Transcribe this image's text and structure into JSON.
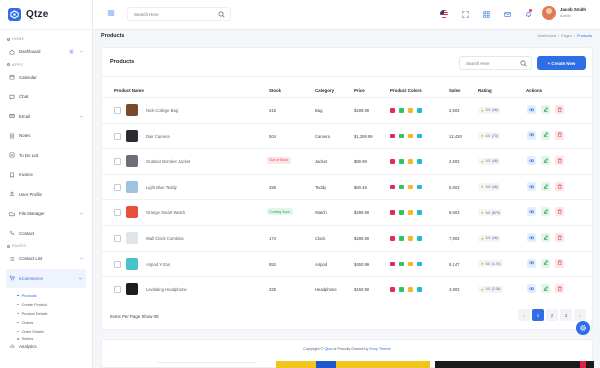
{
  "brand": {
    "name": "Qtze"
  },
  "sidebar": {
    "sections": {
      "home": "HOME",
      "apps": "APPS",
      "pages": "PAGES"
    },
    "home_items": [
      {
        "label": "Dashboard",
        "badge": "6",
        "icon": "home-icon"
      }
    ],
    "app_items": [
      {
        "label": "Calendar",
        "icon": "calendar-icon"
      },
      {
        "label": "Chat",
        "icon": "chat-icon"
      },
      {
        "label": "Email",
        "icon": "mail-icon"
      },
      {
        "label": "Notes",
        "icon": "note-icon"
      },
      {
        "label": "To Do List",
        "icon": "todo-icon"
      },
      {
        "label": "Invoice",
        "icon": "invoice-icon"
      },
      {
        "label": "User Profile",
        "icon": "user-icon"
      },
      {
        "label": "File Manager",
        "icon": "folder-icon"
      },
      {
        "label": "Contact",
        "icon": "contact-icon"
      }
    ],
    "page_items": [
      {
        "label": "Contact List",
        "icon": "list-icon"
      },
      {
        "label": "eCommerce",
        "icon": "cart-icon"
      }
    ],
    "ecommerce_sub": [
      "Products",
      "Create Product",
      "Product Details",
      "Orders",
      "Order Details",
      "Sellers"
    ],
    "analytics_label": "Analytics"
  },
  "header": {
    "search_placeholder": "Search Here",
    "user_name": "Jacob Smith",
    "user_role": "Admin"
  },
  "page": {
    "title": "Products",
    "breadcrumb": [
      "Dashboard",
      "/",
      "Pages",
      "/",
      "Products"
    ]
  },
  "card": {
    "title": "Products",
    "search_placeholder": "Search Here",
    "create_button": "+ Create New"
  },
  "table": {
    "columns": [
      "Product Name",
      "Stock",
      "Category",
      "Price",
      "Product Colors",
      "Sales",
      "Rating",
      "Actions"
    ],
    "rows": [
      {
        "name": "Nick College Bag",
        "stock": "315",
        "stock_badge": "",
        "category": "Bag",
        "price": "$199.99",
        "colors": [
          "#e8285a",
          "#2dc26b",
          "#f5b820",
          "#22b8d8"
        ],
        "sales": "2,603",
        "rating": "5.0",
        "reviews": "(46)"
      },
      {
        "name": "Dair Camera",
        "stock": "504",
        "stock_badge": "",
        "category": "Camera",
        "price": "$1,299.99",
        "colors": [
          "#e8285a",
          "#2dc26b",
          "#f5b820",
          "#22b8d8"
        ],
        "sales": "12,430",
        "rating": "4.0",
        "reviews": "(73)"
      },
      {
        "name": "Outdoor Bomber Jacket",
        "stock": "",
        "stock_badge": "Out of Stock",
        "category": "Jacket",
        "price": "$59.99",
        "colors": [
          "#e8285a",
          "#2dc26b",
          "#f5b820",
          "#22b8d8"
        ],
        "sales": "2,603",
        "rating": "5.0",
        "reviews": "(46)"
      },
      {
        "name": "Light Blue Teddy",
        "stock": "295",
        "stock_badge": "",
        "category": "Teddy",
        "price": "$60.49",
        "colors": [
          "#e8285a",
          "#2dc26b",
          "#f5b820",
          "#22b8d8"
        ],
        "sales": "5,603",
        "rating": "5.0",
        "reviews": "(46)"
      },
      {
        "name": "Orange Smart Watch",
        "stock": "",
        "stock_badge": "Coming Soon",
        "category": "Watch",
        "price": "$289.99",
        "colors": [
          "#e8285a",
          "#2dc26b",
          "#f5b820",
          "#22b8d8"
        ],
        "sales": "8,603",
        "rating": "5.0",
        "reviews": "(879)"
      },
      {
        "name": "Wall Clock Combina",
        "stock": "174",
        "stock_badge": "",
        "category": "Clock",
        "price": "$285.99",
        "colors": [
          "#e8285a",
          "#2dc26b",
          "#f5b820",
          "#22b8d8"
        ],
        "sales": "7,903",
        "rating": "4.0",
        "reviews": "(46)"
      },
      {
        "name": "Airpod Y-Zon",
        "stock": "852",
        "stock_badge": "",
        "category": "Airpod",
        "price": "$450.99",
        "colors": [
          "#e8285a",
          "#2dc26b",
          "#f5b820",
          "#22b8d8"
        ],
        "sales": "8,147",
        "rating": "5.0",
        "reviews": "(1.7k)"
      },
      {
        "name": "Levitating Headphone",
        "stock": "325",
        "stock_badge": "",
        "category": "Headphone",
        "price": "$150.99",
        "colors": [
          "#e8285a",
          "#2dc26b",
          "#f5b820",
          "#22b8d8"
        ],
        "sales": "4,903",
        "rating": "5.0",
        "reviews": "(2.3k)"
      }
    ]
  },
  "pagination": {
    "per_page_label": "Items Per Page Show 08",
    "pages": [
      "1",
      "2",
      "3"
    ],
    "current": 1,
    "prev": "‹",
    "next": "›"
  },
  "footer": {
    "text_before": "Copyright © ",
    "brand": "Qtze",
    "text_middle": " is Proudly Owned by ",
    "owner": "Envy Theme"
  },
  "colors": {
    "accent": "#2f6fe6",
    "success": "#23a457",
    "danger": "#e04858",
    "warning": "#f5b820"
  }
}
